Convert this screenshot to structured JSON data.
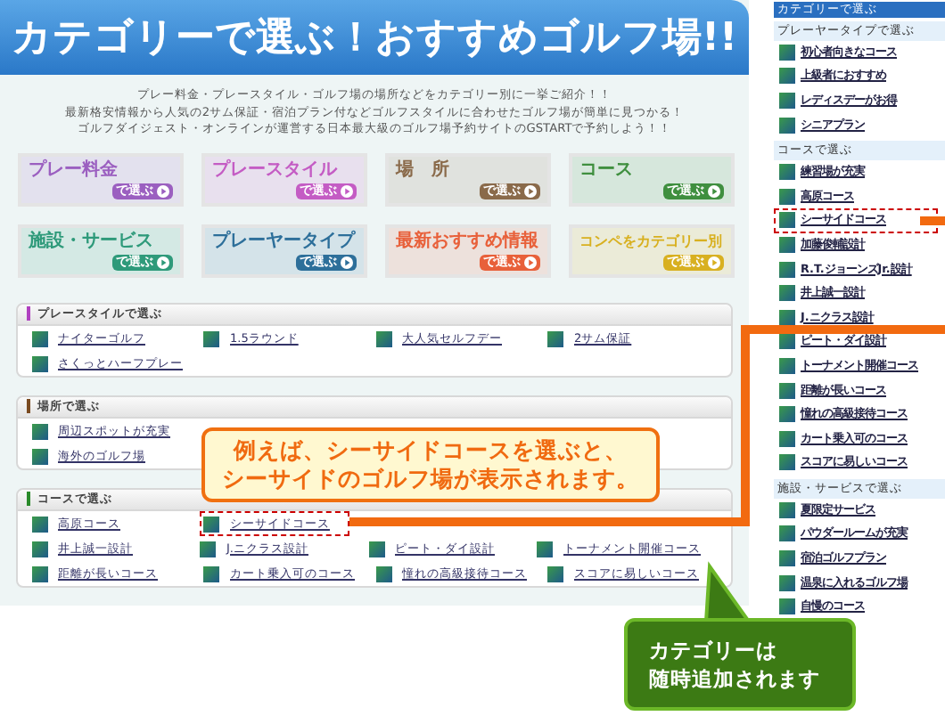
{
  "banner": {
    "title": "カテゴリーで選ぶ！おすすめゴルフ場!!"
  },
  "intro": [
    "プレー料金・プレースタイル・ゴルフ場の場所などをカテゴリー別に一挙ご紹介！！",
    "最新格安情報から人気の2サム保証・宿泊プラン付などゴルフスタイルに合わせたゴルフ場が簡単に見つかる！",
    "ゴルフダイジェスト・オンラインが運営する日本最大級のゴルフ場予約サイトのGSTARTで予約しよう！！"
  ],
  "tiles": [
    {
      "title": "プレー料金",
      "action": "で選ぶ",
      "color": "#9b5fc0"
    },
    {
      "title": "プレースタイル",
      "action": "で選ぶ",
      "color": "#c45cc4"
    },
    {
      "title": "場　所",
      "action": "で選ぶ",
      "color": "#8a6a4a"
    },
    {
      "title": "コース",
      "action": "で選ぶ",
      "color": "#3f8f3f"
    },
    {
      "title": "施設・サービス",
      "action": "で選ぶ",
      "color": "#2e9a7a"
    },
    {
      "title": "プレーヤータイプ",
      "action": "で選ぶ",
      "color": "#2d6f9a"
    },
    {
      "title": "最新おすすめ情報",
      "action": "で選ぶ",
      "color": "#e8603a"
    },
    {
      "title": "コンペをカテゴリー別",
      "action": "で選ぶ",
      "color": "#d8b020"
    }
  ],
  "sections": [
    {
      "title": "プレースタイルで選ぶ",
      "color": "#b040c0",
      "rows": [
        [
          {
            "label": "ナイターゴルフ",
            "highlighted": false
          },
          {
            "label": "1.5ラウンド",
            "highlighted": false
          },
          {
            "label": "大人気セルフデー",
            "highlighted": false
          },
          {
            "label": "2サム保証",
            "highlighted": false
          }
        ],
        [
          {
            "label": "さくっとハーフプレー",
            "highlighted": false
          }
        ]
      ]
    },
    {
      "title": "場所で選ぶ",
      "color": "#7a4a20",
      "rows": [
        [
          {
            "label": "周辺スポットが充実",
            "highlighted": false
          }
        ],
        [
          {
            "label": "海外のゴルフ場",
            "highlighted": false
          }
        ]
      ]
    },
    {
      "title": "コースで選ぶ",
      "color": "#2a8a2a",
      "rows": [
        [
          {
            "label": "高原コース",
            "highlighted": false
          },
          {
            "label": "シーサイドコース",
            "highlighted": true
          }
        ],
        [
          {
            "label": "井上誠一設計",
            "highlighted": false
          },
          {
            "label": "J.ニクラス設計",
            "highlighted": false
          },
          {
            "label": "ピート・ダイ設計",
            "highlighted": false
          },
          {
            "label": "トーナメント開催コース",
            "highlighted": false
          }
        ],
        [
          {
            "label": "距離が長いコース",
            "highlighted": false
          },
          {
            "label": "カート乗入可のコース",
            "highlighted": false
          },
          {
            "label": "憧れの高級接待コース",
            "highlighted": false
          },
          {
            "label": "スコアに易しいコース",
            "highlighted": false
          }
        ]
      ]
    }
  ],
  "sidebar": {
    "title": "カテゴリーで選ぶ",
    "items": [
      {
        "kind": "heading",
        "label": "プレーヤータイプで選ぶ"
      },
      {
        "kind": "link",
        "label": "初心者向きなコース",
        "highlighted": false
      },
      {
        "kind": "link",
        "label": "上級者におすすめ",
        "highlighted": false
      },
      {
        "kind": "link",
        "label": "レディスデーがお得",
        "highlighted": false
      },
      {
        "kind": "link",
        "label": "シニアプラン",
        "highlighted": false
      },
      {
        "kind": "heading",
        "label": "コースで選ぶ"
      },
      {
        "kind": "link",
        "label": "練習場が充実",
        "highlighted": false
      },
      {
        "kind": "link",
        "label": "高原コース",
        "highlighted": false
      },
      {
        "kind": "link",
        "label": "シーサイドコース",
        "highlighted": true
      },
      {
        "kind": "link",
        "label": "加藤俊輔設計",
        "highlighted": false
      },
      {
        "kind": "link",
        "label": "R.T.ジョーンズJr.設計",
        "highlighted": false
      },
      {
        "kind": "link",
        "label": "井上誠一設計",
        "highlighted": false
      },
      {
        "kind": "link",
        "label": "J.ニクラス設計",
        "highlighted": false
      },
      {
        "kind": "link",
        "label": "ピート・ダイ設計",
        "highlighted": false
      },
      {
        "kind": "link",
        "label": "トーナメント開催コース",
        "highlighted": false
      },
      {
        "kind": "link",
        "label": "距離が長いコース",
        "highlighted": false
      },
      {
        "kind": "link",
        "label": "憧れの高級接待コース",
        "highlighted": false
      },
      {
        "kind": "link",
        "label": "カート乗入可のコース",
        "highlighted": false
      },
      {
        "kind": "link",
        "label": "スコアに易しいコース",
        "highlighted": false
      },
      {
        "kind": "heading",
        "label": "施設・サービスで選ぶ"
      },
      {
        "kind": "link",
        "label": "夏限定サービス",
        "highlighted": false
      },
      {
        "kind": "link",
        "label": "パウダールームが充実",
        "highlighted": false
      },
      {
        "kind": "link",
        "label": "宿泊ゴルフプラン",
        "highlighted": false
      },
      {
        "kind": "link",
        "label": "温泉に入れるゴルフ場",
        "highlighted": false
      },
      {
        "kind": "link",
        "label": "自慢のコース",
        "highlighted": false
      }
    ]
  },
  "callouts": [
    {
      "kind": "example",
      "lines": [
        "例えば、シーサイドコースを選ぶと、",
        "シーサイドのゴルフ場が表示されます。"
      ]
    },
    {
      "kind": "note",
      "lines": [
        "カテゴリーは",
        "随時追加されます"
      ]
    }
  ]
}
